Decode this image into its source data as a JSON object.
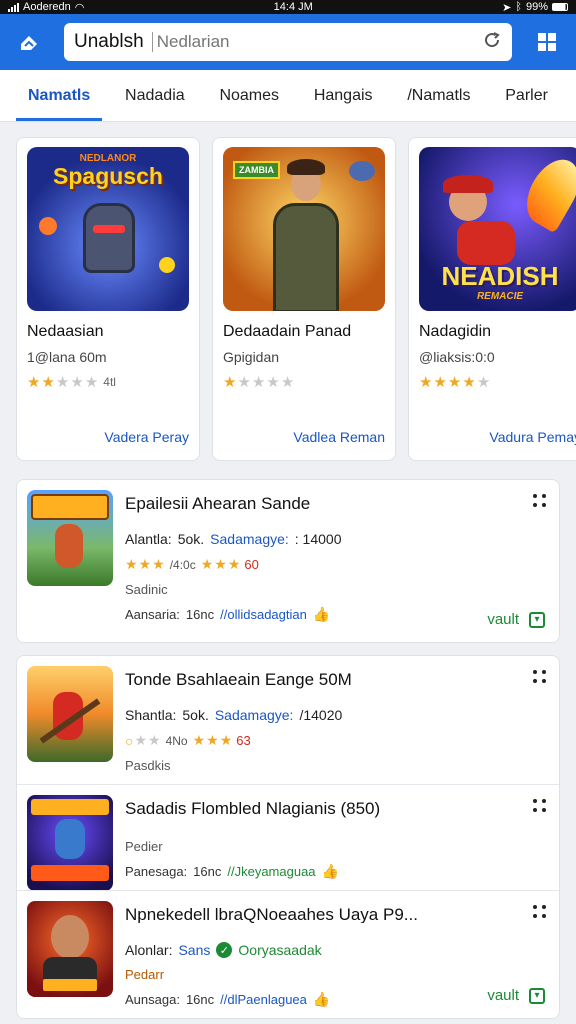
{
  "status_bar": {
    "carrier": "Aoderedn",
    "time": "14:4 JM",
    "battery": "99%"
  },
  "header": {
    "search_value": "Unablsh",
    "search_placeholder": "Nedlarian",
    "icons": {
      "left": "shield-icon",
      "refresh": "refresh-icon",
      "grid": "grid-icon"
    }
  },
  "tabs": [
    {
      "label": "Namatls",
      "active": true
    },
    {
      "label": "Nadadia",
      "active": false
    },
    {
      "label": "Noames",
      "active": false
    },
    {
      "label": "Hangais",
      "active": false
    },
    {
      "label": "/Namatls",
      "active": false
    },
    {
      "label": "Parler",
      "active": false
    }
  ],
  "featured": [
    {
      "art_text": "Spagusch",
      "art_top": "NEDLANOR",
      "title": "Nedaasian",
      "subtitle": "1@lana 60m",
      "rating": 2,
      "count": "4tl",
      "action": "Vadera Peray"
    },
    {
      "art_text": "",
      "art_top": "ZAMBIA",
      "title": "Dedaadain Panad",
      "subtitle": "Gpigidan",
      "rating": 1,
      "count": "",
      "action": "Vadlea Reman"
    },
    {
      "art_text": "NEADISH",
      "art_top": "REMACIE",
      "title": "Nadagidin",
      "subtitle": "@liaksis:0:0",
      "rating": 4,
      "count": "",
      "action": "Vadura Pemay"
    }
  ],
  "list": [
    {
      "title": "Epailesii Ahearan Sande",
      "meta_a": "Alantla:",
      "meta_b": "5ok.",
      "meta_c": "Sadamagye:",
      "meta_d": ": 14000",
      "stars_a": 3,
      "num": "/4:0c",
      "stars_b": 3,
      "red": "60",
      "small": "Sadinic",
      "small_orange": false,
      "foot_a": "Aansaria:",
      "foot_b": "16nc",
      "foot_c": "//ollidsadagtian",
      "foot_c_color": "blue",
      "vault": "vault"
    },
    {
      "title": "Tonde Bsahlaeain Eange 50M",
      "meta_a": "Shantla:",
      "meta_b": "5ok.",
      "meta_c": "Sadamagye:",
      "meta_d": "/14020",
      "stars_a": 1,
      "num": "4No",
      "stars_b": 3,
      "red": "63",
      "small": "Pasdkis",
      "small_orange": false,
      "foot_a": "",
      "foot_b": "",
      "foot_c": "",
      "foot_c_color": "blue",
      "vault": ""
    },
    {
      "title": "Sadadis Flombled Nlagianis (850)",
      "meta_a": "",
      "meta_b": "",
      "meta_c": "",
      "meta_d": "",
      "stars_a": 0,
      "num": "",
      "stars_b": 0,
      "red": "",
      "small": "Pedier",
      "small_orange": false,
      "foot_a": "Panesaga:",
      "foot_b": "16nc",
      "foot_c": "//Jkeyamaguaa",
      "foot_c_color": "green",
      "vault": ""
    },
    {
      "title": "Npnekedell lbraQNoeaahes Uaya P9...",
      "meta_a": "Alonlar:",
      "meta_b": "Sans",
      "meta_c": "Ooryasaadak",
      "meta_d": "",
      "stars_a": 0,
      "num": "",
      "stars_b": 0,
      "red": "",
      "small": "Pedarr",
      "small_orange": true,
      "foot_a": "Aunsaga:",
      "foot_b": "16nc",
      "foot_c": "//dlPaenlaguea",
      "foot_c_color": "blue",
      "vault": "vault"
    }
  ],
  "colors": {
    "header": "#1f6fe0",
    "accent": "#1a56c4",
    "star": "#f0a824",
    "green": "#1c8a34",
    "red": "#d12b1f"
  }
}
